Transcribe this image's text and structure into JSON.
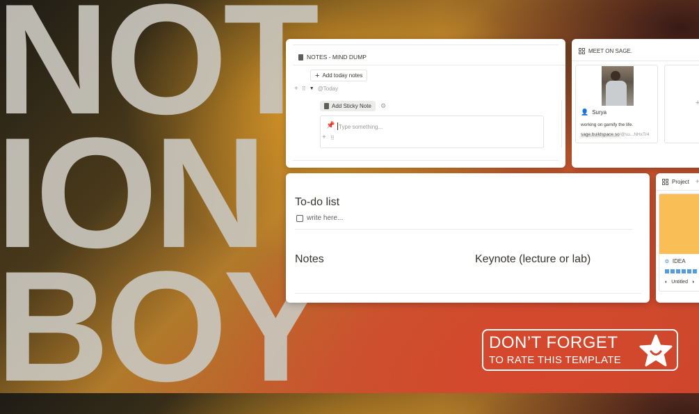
{
  "background_text": [
    "NOT",
    "ION",
    "BOY"
  ],
  "notes_panel": {
    "title": "NOTES - MIND DUMP",
    "add_today_label": "Add today notes",
    "today_label": "@Today",
    "add_sticky_label": "Add Sticky Note",
    "sticky_placeholder": "Type something..."
  },
  "meet_panel": {
    "title": "MEET ON SAGE.",
    "card": {
      "name": "Surya",
      "description": "working on gamify the life.",
      "link_domain": "sage.buildspace.so",
      "link_handle": "/@su...NHxTr4"
    }
  },
  "todo_panel": {
    "todo_heading": "To-do list",
    "todo_placeholder": "write here...",
    "notes_heading": "Notes",
    "keynote_heading": "Keynote (lecture or lab)"
  },
  "project_panel": {
    "title": "Project",
    "card_tag": "IDEA",
    "card_untitled": "Untitled"
  },
  "cta": {
    "line1": "DON’T FORGET",
    "line2": "TO RATE THIS TEMPLATE"
  },
  "colors": {
    "project_cover": "#f9bf56",
    "progress_blue": "#529cdb",
    "cta_border": "#ffffff"
  }
}
